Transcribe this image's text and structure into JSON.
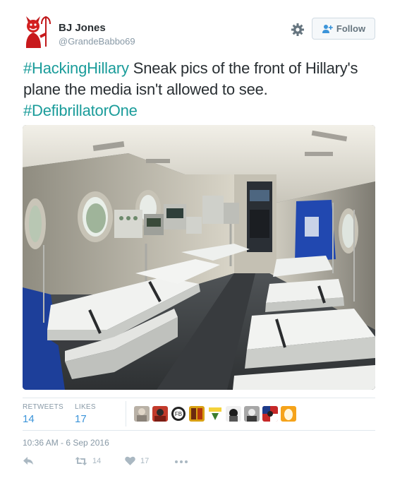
{
  "user": {
    "name": "BJ Jones",
    "handle": "@GrandeBabbo69"
  },
  "follow_label": "Follow",
  "tweet": {
    "hashtag1": "#HackingHillary",
    "text": " Sneak pics of the front of Hillary's plane the media isn't allowed to see. ",
    "hashtag2": "#DefibrillatorOne"
  },
  "stats": {
    "retweets_label": "RETWEETS",
    "retweets_value": "14",
    "likes_label": "LIKES",
    "likes_value": "17"
  },
  "timestamp": "10:36 AM - 6 Sep 2016",
  "actions": {
    "retweet_count": "14",
    "like_count": "17"
  },
  "colors": {
    "hashtag": "#1a9c9a",
    "stat_value": "#3b94d9",
    "muted": "#8899a6"
  },
  "icons": [
    "devil-avatar",
    "gear-icon",
    "add-person-icon",
    "reply-icon",
    "retweet-icon",
    "heart-icon",
    "more-icon"
  ]
}
